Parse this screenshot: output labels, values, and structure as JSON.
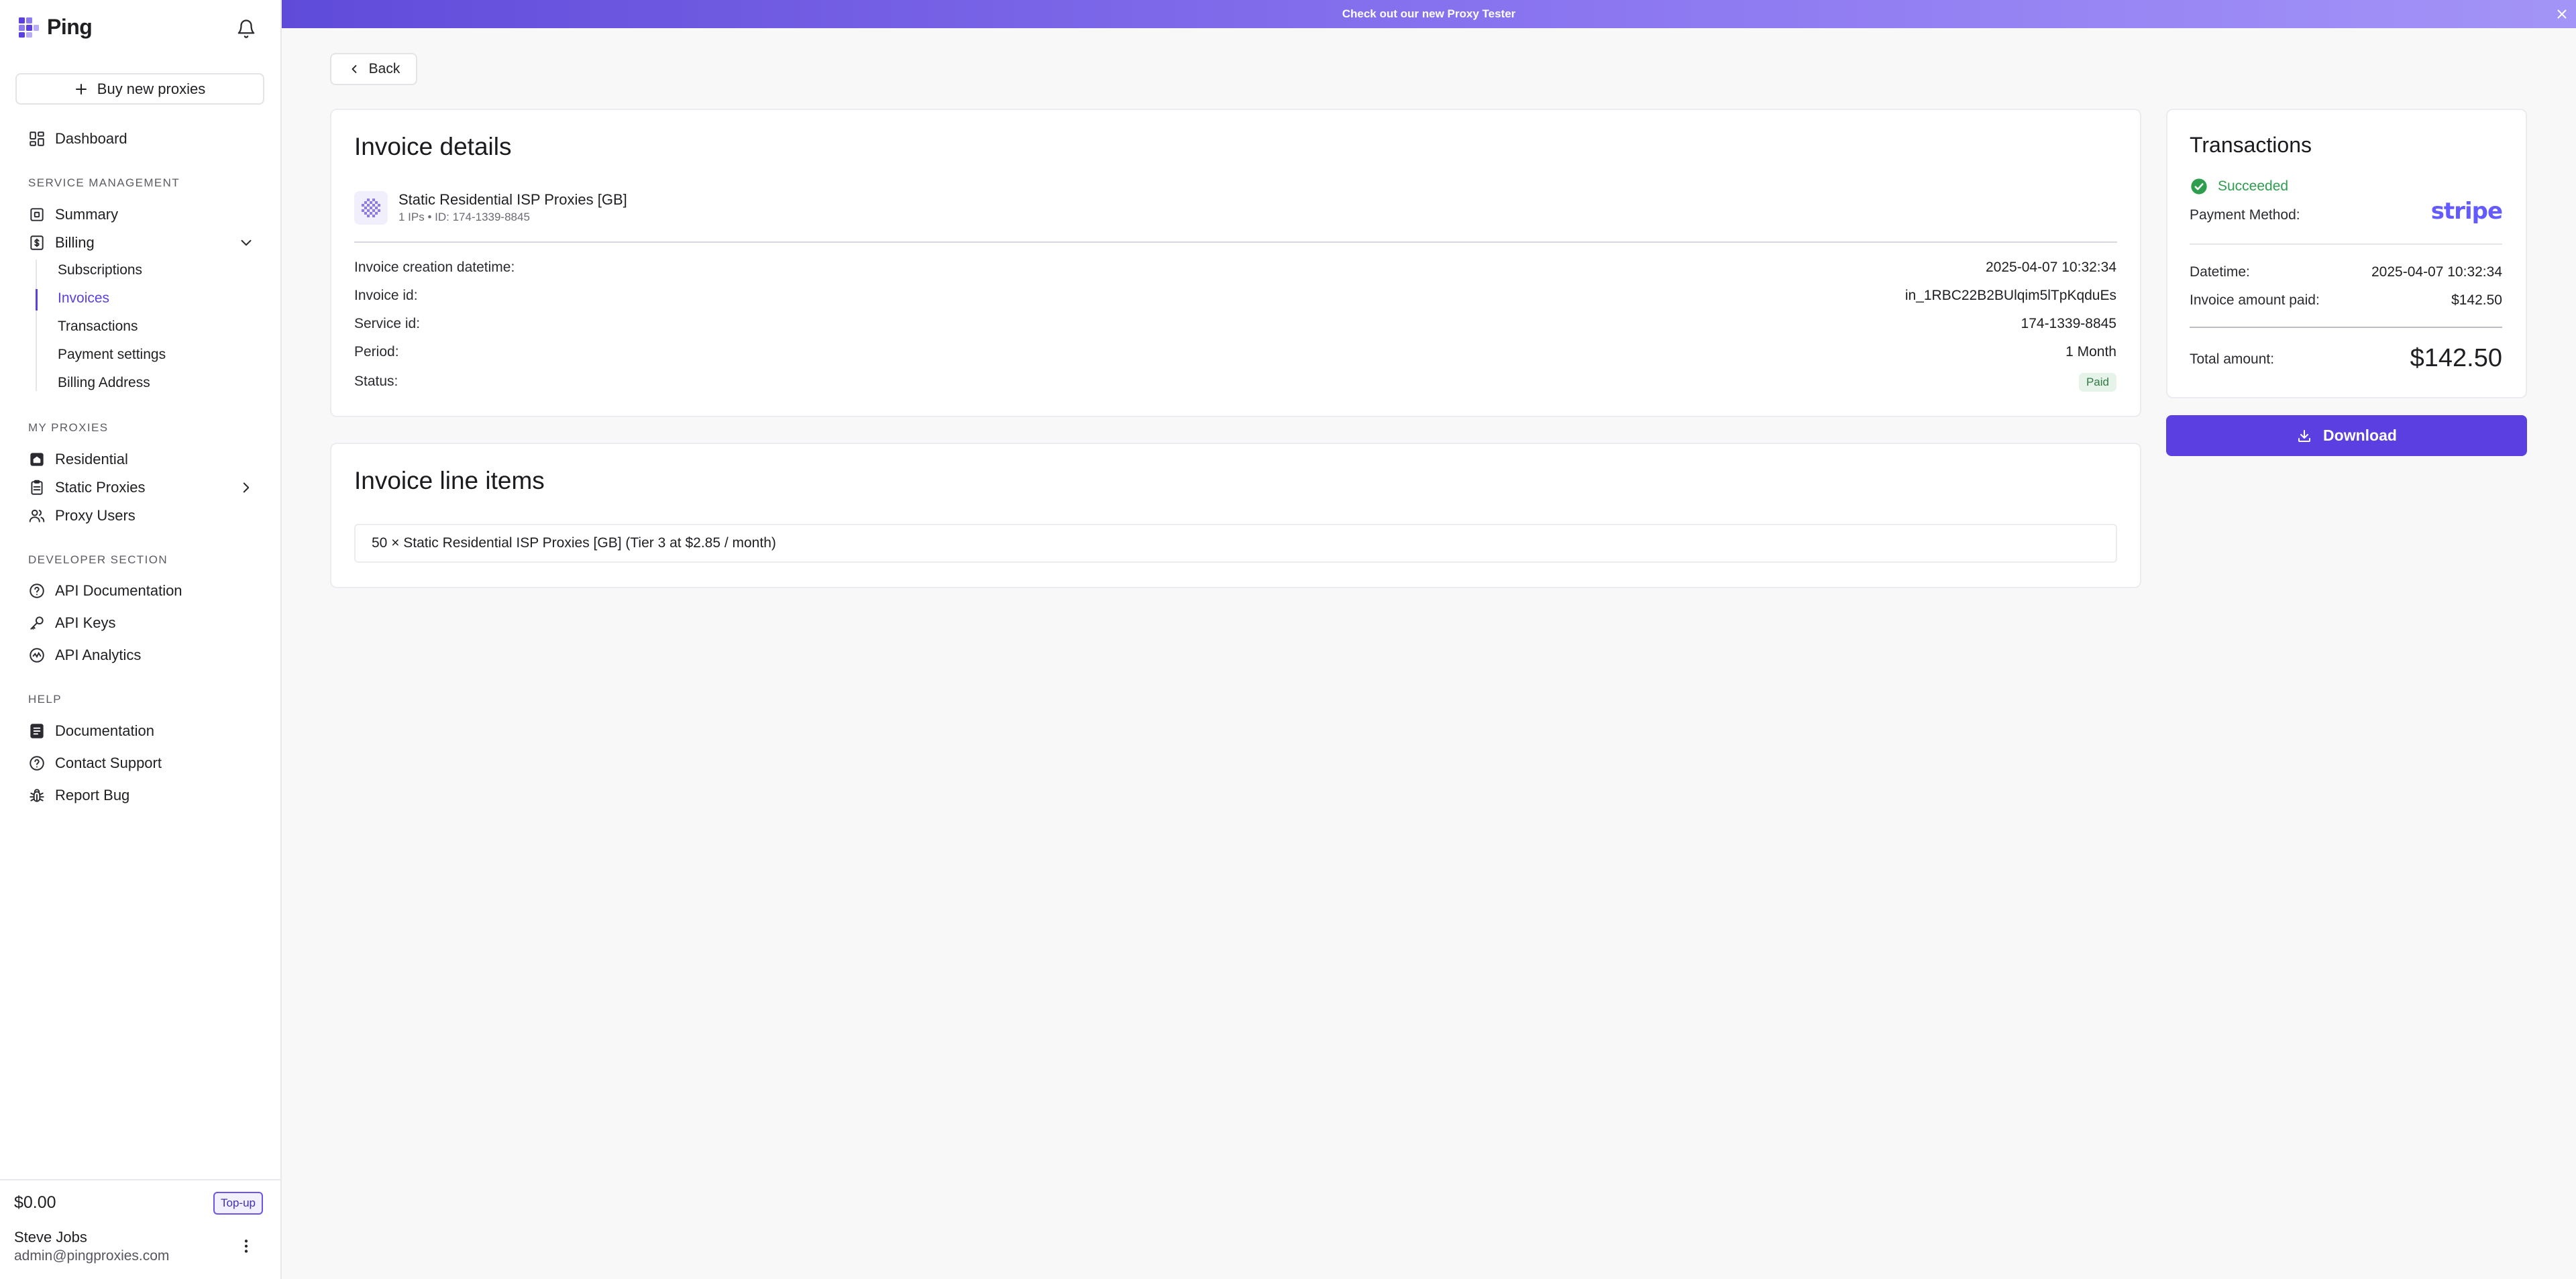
{
  "brand": {
    "name": "Ping"
  },
  "sidebar": {
    "buy_label": "Buy new proxies",
    "dashboard": "Dashboard",
    "service_section": "SERVICE MANAGEMENT",
    "summary": "Summary",
    "billing": "Billing",
    "billing_sub": [
      "Subscriptions",
      "Invoices",
      "Transactions",
      "Payment settings",
      "Billing Address"
    ],
    "active_sub": "Invoices",
    "proxies_section": "MY PROXIES",
    "residential": "Residential",
    "static_proxies": "Static Proxies",
    "proxy_users": "Proxy Users",
    "developer_section": "DEVELOPER SECTION",
    "api_docs": "API Documentation",
    "api_keys": "API Keys",
    "api_analytics": "API Analytics",
    "help_section": "HELP",
    "documentation": "Documentation",
    "contact_support": "Contact Support",
    "report_bug": "Report Bug",
    "balance": "$0.00",
    "topup_label": "Top-up",
    "user_name": "Steve Jobs",
    "user_email": "admin@pingproxies.com"
  },
  "banner": {
    "text": "Check out our new Proxy Tester"
  },
  "back_label": "Back",
  "invoice": {
    "title": "Invoice details",
    "product_name": "Static Residential ISP Proxies [GB]",
    "product_meta": "1 IPs • ID: 174-1339-8845",
    "creation_label": "Invoice creation datetime:",
    "creation_value": "2025-04-07 10:32:34",
    "id_label": "Invoice id:",
    "id_value": "in_1RBC22B2BUlqim5lTpKqduEs",
    "service_label": "Service id:",
    "service_value": "174-1339-8845",
    "period_label": "Period:",
    "period_value": "1 Month",
    "status_label": "Status:",
    "status_value": "Paid"
  },
  "line_items": {
    "title": "Invoice line items",
    "items": [
      "50 × Static Residential ISP Proxies [GB] (Tier 3 at $2.85 / month)"
    ]
  },
  "transactions": {
    "title": "Transactions",
    "status": "Succeeded",
    "payment_method_label": "Payment Method:",
    "payment_method_value": "stripe",
    "datetime_label": "Datetime:",
    "datetime_value": "2025-04-07 10:32:34",
    "amount_paid_label": "Invoice amount paid:",
    "amount_paid_value": "$142.50",
    "total_label": "Total amount:",
    "total_value": "$142.50",
    "download_label": "Download"
  },
  "colors": {
    "accent": "#5b3fe0",
    "success": "#2e9e4e",
    "stripe": "#635bff"
  }
}
